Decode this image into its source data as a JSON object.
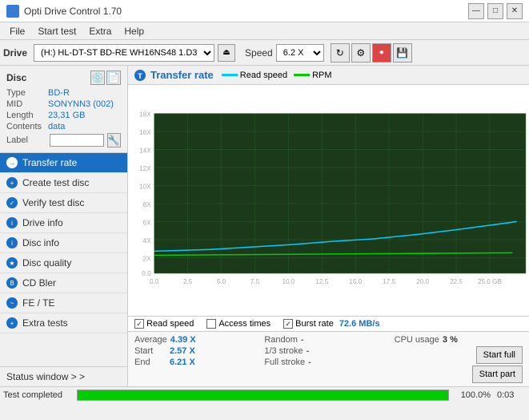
{
  "titlebar": {
    "title": "Opti Drive Control 1.70",
    "min_btn": "—",
    "max_btn": "□",
    "close_btn": "✕"
  },
  "menubar": {
    "items": [
      "File",
      "Start test",
      "Extra",
      "Help"
    ]
  },
  "toolbar": {
    "drive_label": "Drive",
    "drive_value": "(H:)  HL-DT-ST BD-RE  WH16NS48 1.D3",
    "speed_label": "Speed",
    "speed_value": "6.2 X"
  },
  "sidebar": {
    "disc_title": "Disc",
    "disc_fields": [
      {
        "label": "Type",
        "value": "BD-R"
      },
      {
        "label": "MID",
        "value": "SONYNN3 (002)"
      },
      {
        "label": "Length",
        "value": "23,31 GB"
      },
      {
        "label": "Contents",
        "value": "data"
      }
    ],
    "label_placeholder": "",
    "nav_items": [
      {
        "label": "Transfer rate",
        "active": true
      },
      {
        "label": "Create test disc",
        "active": false
      },
      {
        "label": "Verify test disc",
        "active": false
      },
      {
        "label": "Drive info",
        "active": false
      },
      {
        "label": "Disc info",
        "active": false
      },
      {
        "label": "Disc quality",
        "active": false
      },
      {
        "label": "CD Bler",
        "active": false
      },
      {
        "label": "FE / TE",
        "active": false
      },
      {
        "label": "Extra tests",
        "active": false
      }
    ],
    "status_window_btn": "Status window > >"
  },
  "chart": {
    "title": "Transfer rate",
    "legend": [
      {
        "label": "Read speed",
        "color": "#00ccff"
      },
      {
        "label": "RPM",
        "color": "#00cc00"
      }
    ],
    "y_axis_labels": [
      "18 X",
      "16 X",
      "14 X",
      "12 X",
      "10 X",
      "8 X",
      "6 X",
      "4 X",
      "2 X",
      "0.0"
    ],
    "x_axis_labels": [
      "0.0",
      "2.5",
      "5.0",
      "7.5",
      "10.0",
      "12.5",
      "15.0",
      "17.5",
      "20.0",
      "22.5",
      "25.0 GB"
    ],
    "checkboxes": [
      {
        "label": "Read speed",
        "checked": true,
        "color": "#00ccff"
      },
      {
        "label": "Access times",
        "checked": false,
        "color": "#aaa"
      },
      {
        "label": "Burst rate",
        "checked": true,
        "color": "#cc0000"
      }
    ],
    "burst_rate": "72.6 MB/s"
  },
  "stats": {
    "col1": [
      {
        "label": "Average",
        "value": "4.39 X"
      },
      {
        "label": "Start",
        "value": "2.57 X"
      },
      {
        "label": "End",
        "value": "6.21 X"
      }
    ],
    "col2": [
      {
        "label": "Random",
        "value": "-"
      },
      {
        "label": "1/3 stroke",
        "value": "-"
      },
      {
        "label": "Full stroke",
        "value": "-"
      }
    ],
    "col3": [
      {
        "label": "CPU usage",
        "value": "3 %"
      },
      {
        "label": "",
        "value": ""
      },
      {
        "label": "",
        "value": ""
      }
    ],
    "btn_full": "Start full",
    "btn_part": "Start part"
  },
  "statusbar": {
    "text": "Test completed",
    "progress_pct": 100,
    "progress_label": "100.0%",
    "time": "0:03"
  }
}
